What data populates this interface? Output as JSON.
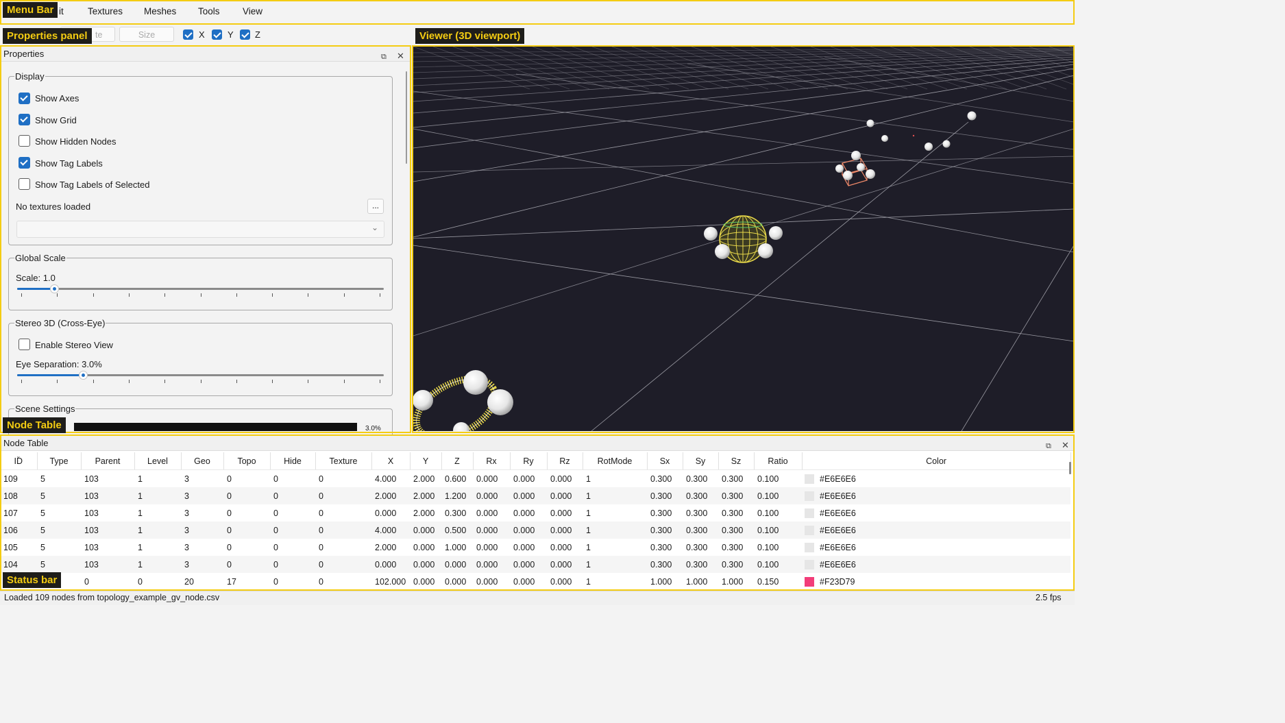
{
  "labels": {
    "menu_bar": "Menu Bar",
    "properties_panel": "Properties panel",
    "viewer": "Viewer (3D viewport)",
    "node_table": "Node Table",
    "status_bar": "Status bar"
  },
  "menu": {
    "partial_item": "it",
    "items": [
      "Textures",
      "Meshes",
      "Tools",
      "View"
    ]
  },
  "toolbar": {
    "partial_input": "te",
    "size_placeholder": "Size",
    "axes": [
      {
        "label": "X",
        "checked": true
      },
      {
        "label": "Y",
        "checked": true
      },
      {
        "label": "Z",
        "checked": true
      }
    ]
  },
  "properties": {
    "title": "Properties",
    "display": {
      "legend": "Display",
      "options": [
        {
          "label": "Show Axes",
          "checked": true
        },
        {
          "label": "Show Grid",
          "checked": true
        },
        {
          "label": "Show Hidden Nodes",
          "checked": false
        },
        {
          "label": "Show Tag Labels",
          "checked": true
        },
        {
          "label": "Show Tag Labels of Selected",
          "checked": false
        }
      ],
      "textures_text": "No textures loaded",
      "browse_label": "..."
    },
    "global_scale": {
      "legend": "Global Scale",
      "label": "Scale: 1.0",
      "value_fraction": 0.1
    },
    "stereo": {
      "legend": "Stereo 3D (Cross-Eye)",
      "enable_label": "Enable Stereo View",
      "enable_checked": false,
      "eye_label": "Eye Separation: 3.0%",
      "value_fraction": 0.18
    },
    "scene": {
      "legend": "Scene Settings",
      "partial_value": "3.0%"
    }
  },
  "node_table": {
    "title": "Node Table",
    "columns": [
      "ID",
      "Type",
      "Parent",
      "Level",
      "Geo",
      "Topo",
      "Hide",
      "Texture",
      "X",
      "Y",
      "Z",
      "Rx",
      "Ry",
      "Rz",
      "RotMode",
      "Sx",
      "Sy",
      "Sz",
      "Ratio",
      "Color"
    ],
    "rows": [
      {
        "cells": [
          "109",
          "5",
          "103",
          "1",
          "3",
          "0",
          "0",
          "0",
          "4.000",
          "2.000",
          "0.600",
          "0.000",
          "0.000",
          "0.000",
          "1",
          "0.300",
          "0.300",
          "0.300",
          "0.100"
        ],
        "color": "#E6E6E6"
      },
      {
        "cells": [
          "108",
          "5",
          "103",
          "1",
          "3",
          "0",
          "0",
          "0",
          "2.000",
          "2.000",
          "1.200",
          "0.000",
          "0.000",
          "0.000",
          "1",
          "0.300",
          "0.300",
          "0.300",
          "0.100"
        ],
        "color": "#E6E6E6"
      },
      {
        "cells": [
          "107",
          "5",
          "103",
          "1",
          "3",
          "0",
          "0",
          "0",
          "0.000",
          "2.000",
          "0.300",
          "0.000",
          "0.000",
          "0.000",
          "1",
          "0.300",
          "0.300",
          "0.300",
          "0.100"
        ],
        "color": "#E6E6E6"
      },
      {
        "cells": [
          "106",
          "5",
          "103",
          "1",
          "3",
          "0",
          "0",
          "0",
          "4.000",
          "0.000",
          "0.500",
          "0.000",
          "0.000",
          "0.000",
          "1",
          "0.300",
          "0.300",
          "0.300",
          "0.100"
        ],
        "color": "#E6E6E6"
      },
      {
        "cells": [
          "105",
          "5",
          "103",
          "1",
          "3",
          "0",
          "0",
          "0",
          "2.000",
          "0.000",
          "1.000",
          "0.000",
          "0.000",
          "0.000",
          "1",
          "0.300",
          "0.300",
          "0.300",
          "0.100"
        ],
        "color": "#E6E6E6"
      },
      {
        "cells": [
          "104",
          "5",
          "103",
          "1",
          "3",
          "0",
          "0",
          "0",
          "0.000",
          "0.000",
          "0.000",
          "0.000",
          "0.000",
          "0.000",
          "1",
          "0.300",
          "0.300",
          "0.300",
          "0.100"
        ],
        "color": "#E6E6E6"
      },
      {
        "cells": [
          "",
          "",
          "0",
          "0",
          "20",
          "17",
          "0",
          "0",
          "102.000",
          "0.000",
          "0.000",
          "0.000",
          "0.000",
          "0.000",
          "1",
          "1.000",
          "1.000",
          "1.000",
          "0.150"
        ],
        "color": "#F23D79"
      }
    ]
  },
  "status": {
    "message": "Loaded 109 nodes from topology_example_gv_node.csv",
    "fps": "2.5 fps"
  }
}
